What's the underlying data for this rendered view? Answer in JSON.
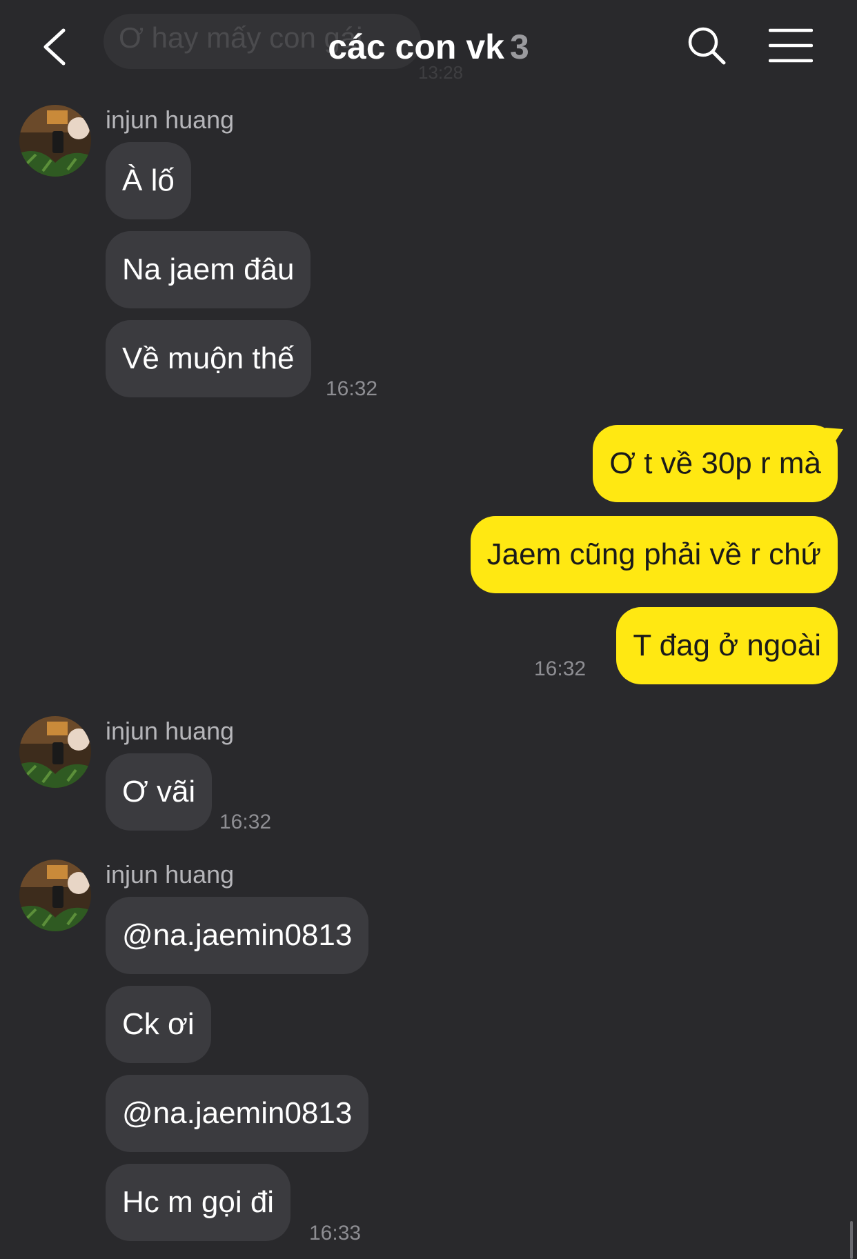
{
  "header": {
    "title": "các con vk",
    "member_count": "3",
    "ghost_preview": "Ơ hay mấy con gái",
    "ghost_time": "13:28"
  },
  "icons": {
    "back": "chevron-left-icon",
    "search": "search-icon",
    "menu": "hamburger-menu-icon"
  },
  "colors": {
    "background": "#29292c",
    "incoming_bubble": "#3b3b3f",
    "outgoing_bubble": "#ffe812",
    "timestamp": "#8e8e93"
  },
  "groups": [
    {
      "sender": "injun huang",
      "messages": [
        "À lố",
        "Na jaem đâu",
        "Về muộn thế"
      ],
      "time": "16:32"
    },
    {
      "sender": "me",
      "messages": [
        "Ơ t về 30p r mà",
        "Jaem cũng phải về r chứ",
        "T đag ở ngoài"
      ],
      "time": "16:32"
    },
    {
      "sender": "injun huang",
      "messages": [
        "Ơ vãi"
      ],
      "time": "16:32"
    },
    {
      "sender": "injun huang",
      "messages": [
        "@na.jaemin0813",
        "Ck ơi",
        "@na.jaemin0813",
        "Hc m gọi đi"
      ],
      "time": "16:33"
    }
  ]
}
